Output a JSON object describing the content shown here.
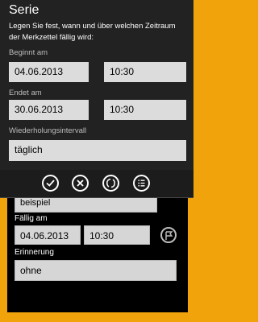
{
  "background_form": {
    "reminder_partial_value": "beispiel",
    "due_label": "Fällig am",
    "due_date": "04.06.2013",
    "due_time": "10:30",
    "reminder_label": "Erinnerung",
    "reminder_value": "ohne"
  },
  "series_dialog": {
    "title": "Serie",
    "description": "Legen Sie fest, wann und über welchen Zeitraum der Merkzettel fällig wird:",
    "start_label": "Beginnt am",
    "start_date": "04.06.2013",
    "start_time": "10:30",
    "end_label": "Endet am",
    "end_date": "30.06.2013",
    "end_time": "10:30",
    "interval_label": "Wiederholungsintervall",
    "interval_value": "täglich"
  },
  "app_bar": {
    "icons": [
      "check-icon",
      "cancel-icon",
      "recurrence-icon",
      "list-icon"
    ]
  },
  "colors": {
    "accent": "#f0a30a",
    "dialog_bg": "#222222",
    "field_bg": "#dcdcdc"
  }
}
